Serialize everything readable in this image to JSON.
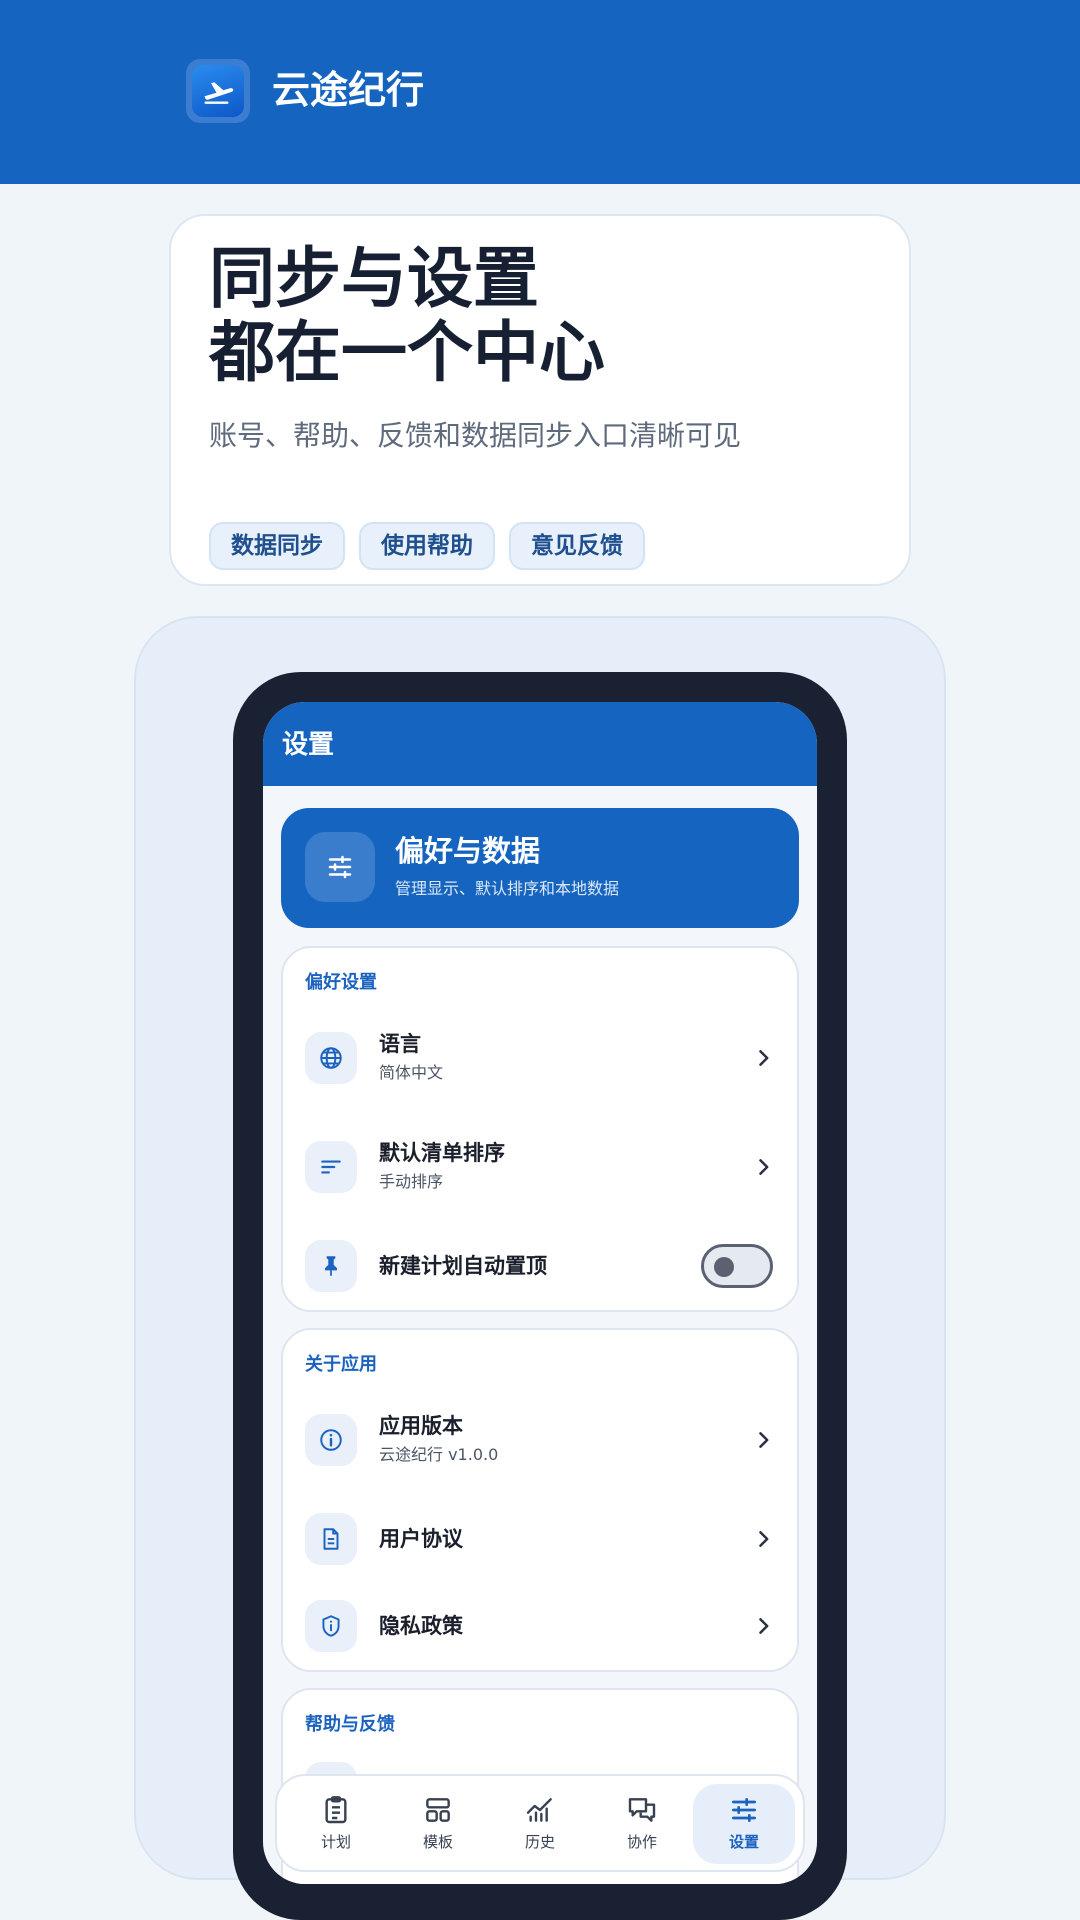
{
  "app": {
    "name": "云途纪行",
    "logo_icon": "airplane-logo-icon",
    "brand_color": "#1565c0"
  },
  "hero": {
    "title_line1": "同步与设置",
    "title_line2": "都在一个中心",
    "subtitle": "账号、帮助、反馈和数据同步入口清晰可见",
    "chips": [
      "数据同步",
      "使用帮助",
      "意见反馈"
    ]
  },
  "screen": {
    "title": "设置",
    "preferences_card": {
      "title": "偏好与数据",
      "subtitle": "管理显示、默认排序和本地数据",
      "icon": "sliders-icon"
    },
    "sections": [
      {
        "title": "偏好设置",
        "items": [
          {
            "title": "语言",
            "subtitle": "简体中文",
            "icon": "globe-icon",
            "control": "chevron"
          },
          {
            "title": "默认清单排序",
            "subtitle": "手动排序",
            "icon": "sort-icon",
            "control": "chevron"
          },
          {
            "title": "新建计划自动置顶",
            "icon": "pin-icon",
            "control": "toggle",
            "toggle_on": false
          }
        ]
      },
      {
        "title": "关于应用",
        "items": [
          {
            "title": "应用版本",
            "subtitle": "云途纪行 v1.0.0",
            "icon": "info-icon",
            "control": "chevron"
          },
          {
            "title": "用户协议",
            "icon": "document-icon",
            "control": "chevron"
          },
          {
            "title": "隐私政策",
            "icon": "shield-icon",
            "control": "chevron"
          }
        ]
      },
      {
        "title": "帮助与反馈"
      }
    ],
    "tabs": [
      {
        "label": "计划",
        "icon": "clipboard-icon",
        "active": false
      },
      {
        "label": "模板",
        "icon": "template-icon",
        "active": false
      },
      {
        "label": "历史",
        "icon": "chart-icon",
        "active": false
      },
      {
        "label": "协作",
        "icon": "chat-icon",
        "active": false
      },
      {
        "label": "设置",
        "icon": "sliders-icon",
        "active": true
      }
    ]
  }
}
